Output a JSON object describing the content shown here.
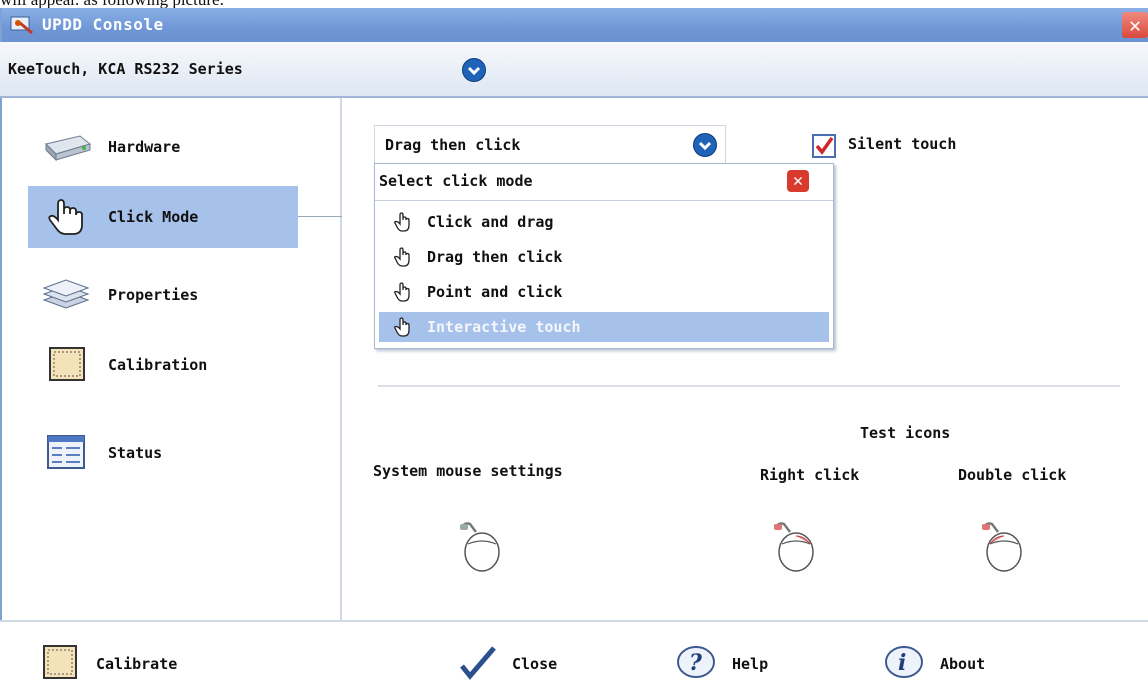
{
  "caption": "will appear. as following picture:",
  "window": {
    "title": "UPDD Console",
    "close_glyph": "✕"
  },
  "device": {
    "name": "KeeTouch, KCA RS232 Series"
  },
  "sidebar": {
    "items": [
      {
        "label": "Hardware",
        "icon": "hardware-icon"
      },
      {
        "label": "Click Mode",
        "icon": "hand-pointer-icon",
        "active": true
      },
      {
        "label": "Properties",
        "icon": "layers-icon"
      },
      {
        "label": "Calibration",
        "icon": "calibration-icon"
      },
      {
        "label": "Status",
        "icon": "status-icon"
      }
    ]
  },
  "click_mode": {
    "selected": "Drag then click",
    "silent_touch": {
      "label": "Silent touch",
      "checked": true
    },
    "popup": {
      "title": "Select click mode",
      "close_glyph": "✕",
      "options": [
        "Click and drag",
        "Drag then click",
        "Point and click",
        "Interactive touch"
      ],
      "highlighted_index": 3
    }
  },
  "settings": {
    "system_mouse": "System mouse settings",
    "test_icons": "Test icons",
    "right_click": "Right click",
    "double_click": "Double click"
  },
  "bottom": {
    "calibrate": "Calibrate",
    "close": "Close",
    "help": "Help",
    "about": "About"
  },
  "colors": {
    "title_bar": "#6f97d6",
    "selection": "#a7c2ea",
    "close_red": "#d94a3c",
    "round_button": "#1e63b8"
  }
}
